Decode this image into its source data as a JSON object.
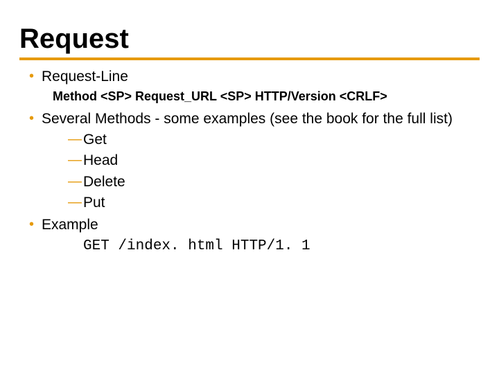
{
  "title": "Request",
  "bullets": {
    "b1": "Request-Line",
    "syntax": "Method <SP> Request_URL <SP> HTTP/Version <CRLF>",
    "b2": "Several Methods - some examples (see the book for the full list)",
    "methods": {
      "m1": "Get",
      "m2": "Head",
      "m3": "Delete",
      "m4": "Put"
    },
    "b3": "Example",
    "example_code": "GET /index. html HTTP/1. 1"
  }
}
